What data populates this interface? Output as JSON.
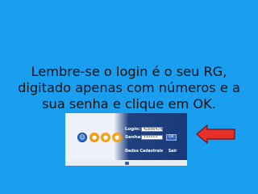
{
  "instruction": {
    "line1": "Lembre-se o login é o seu RG,",
    "line2": "digitado apenas com números e a",
    "line3": "sua senha e clique em OK."
  },
  "login_form": {
    "login_label": "Login:",
    "login_value": "42696474",
    "senha_label": "Senha:",
    "senha_value": "••••••",
    "ok_label": "OK",
    "dados_cadastrais_link": "Dados Cadastrais",
    "sair_link": "Sair"
  },
  "icons": [
    "user-icon",
    "orange-circle-icon",
    "orange-circle-icon",
    "orange-circle-icon"
  ],
  "colors": {
    "background": "#1a9ff0",
    "panel": "#20407f",
    "arrow_fill": "#e8302a",
    "arrow_stroke": "#7a1010"
  }
}
